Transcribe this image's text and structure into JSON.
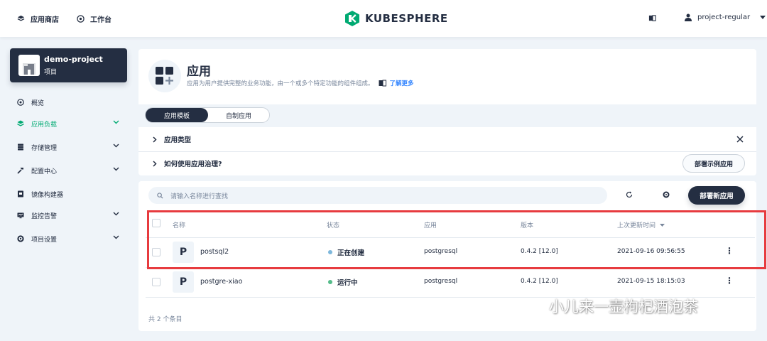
{
  "topbar": {
    "app_store": "应用商店",
    "workbench": "工作台",
    "logo": "KUBESPHERE",
    "user": "project-regular"
  },
  "sidebar": {
    "project_name": "demo-project",
    "project_type": "项目",
    "items": [
      {
        "label": "概览"
      },
      {
        "label": "应用负载"
      },
      {
        "label": "存储管理"
      },
      {
        "label": "配置中心"
      },
      {
        "label": "镜像构建器"
      },
      {
        "label": "监控告警"
      },
      {
        "label": "项目设置"
      }
    ]
  },
  "header": {
    "title": "应用",
    "description": "应用为用户提供完整的业务功能，由一个或多个特定功能的组件组成。",
    "learn_more": "了解更多"
  },
  "tabs": [
    {
      "label": "应用模板"
    },
    {
      "label": "自制应用"
    }
  ],
  "collapse": {
    "app_types": "应用类型",
    "how_to": "如何使用应用治理?",
    "deploy_sample": "部署示例应用"
  },
  "list": {
    "search_placeholder": "请输入名称进行查找",
    "deploy_new": "部署新应用",
    "columns": [
      "名称",
      "状态",
      "应用",
      "版本",
      "上次更新时间"
    ],
    "rows": [
      {
        "icon": "P",
        "name": "postsql2",
        "status": "正在创建",
        "status_color": "#7eb8dc",
        "app": "postgresql",
        "version": "0.4.2 [12.0]",
        "updated": "2021-09-16 09:56:55"
      },
      {
        "icon": "P",
        "name": "postgre-xiao",
        "status": "运行中",
        "status_color": "#55bc8a",
        "app": "postgresql",
        "version": "0.4.2 [12.0]",
        "updated": "2021-09-15 18:15:03"
      }
    ],
    "total": "共 2 个条目"
  },
  "watermark": "小儿来一壶枸杞酒泡茶",
  "colors": {
    "accent": "#00aa72",
    "dark": "#242e42",
    "highlight": "#e73b3f",
    "link": "#3385ff"
  }
}
